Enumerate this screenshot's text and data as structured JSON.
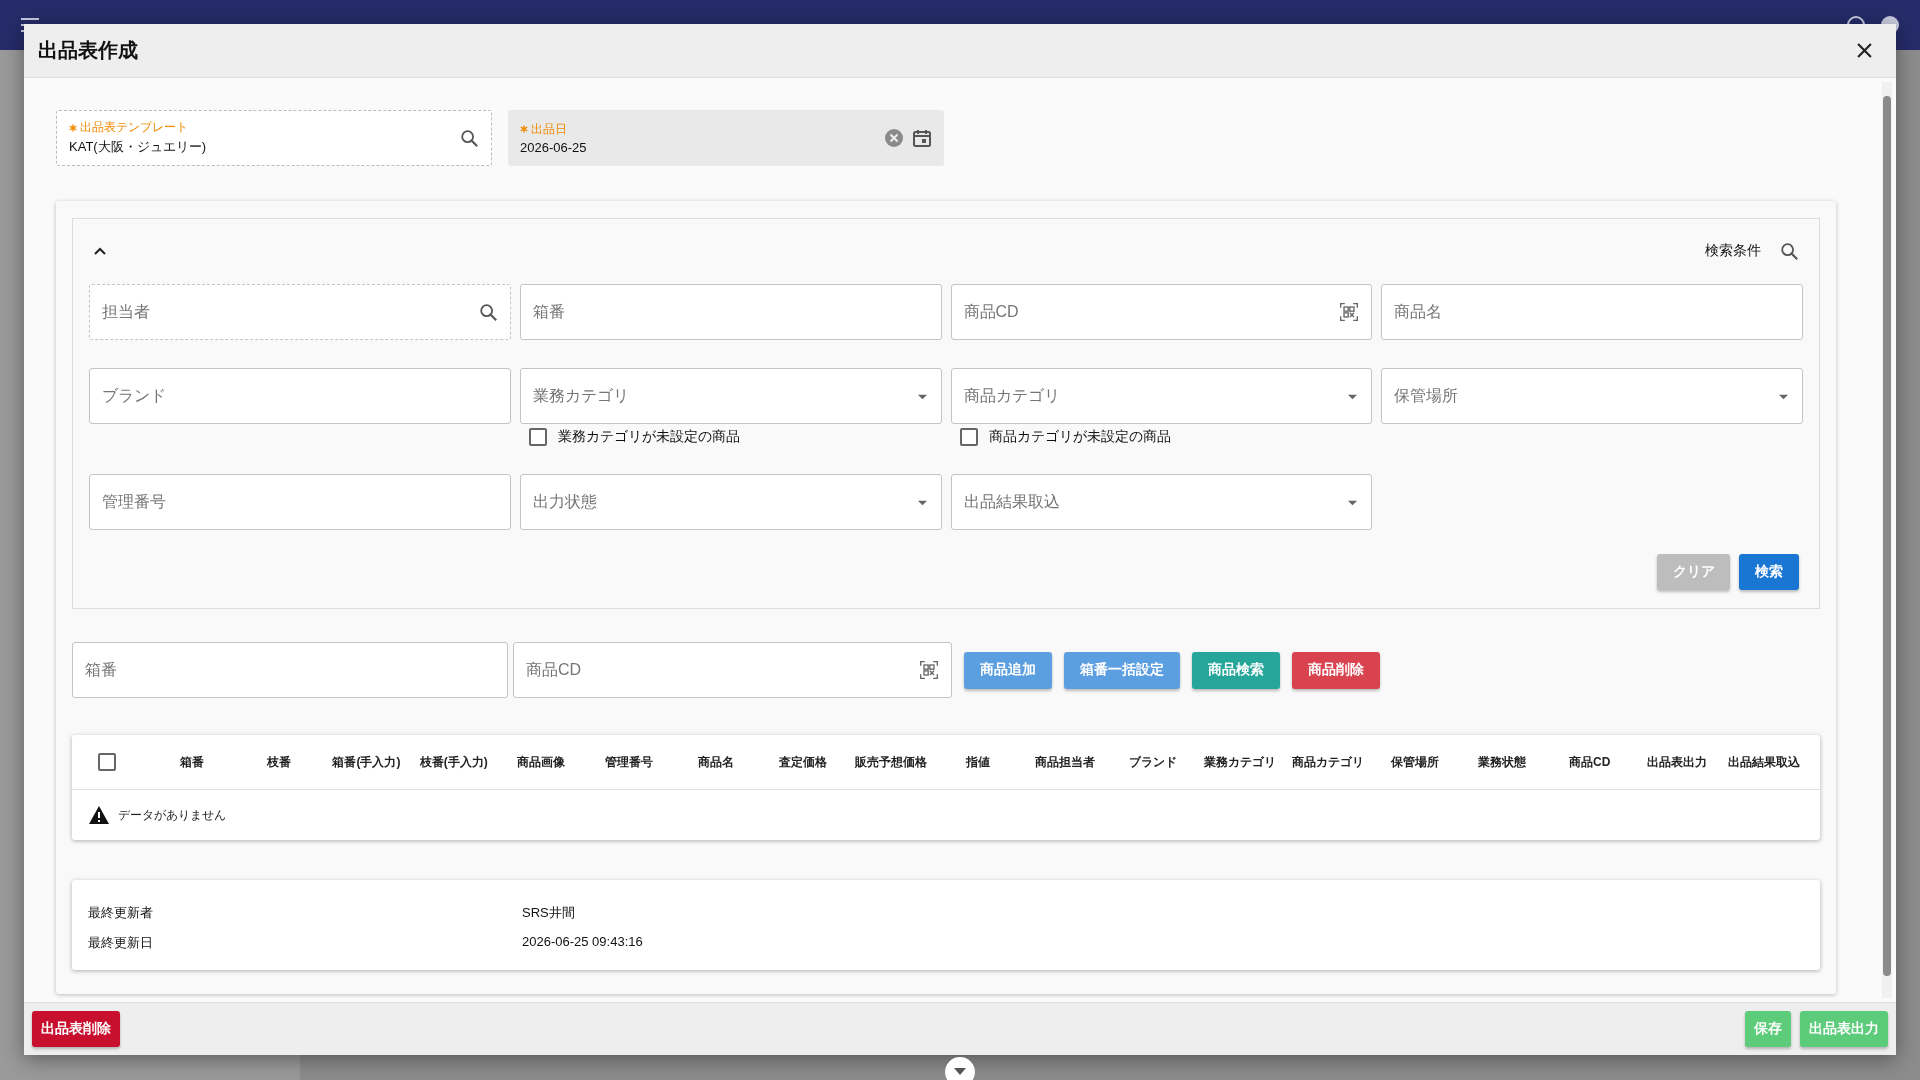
{
  "dialog": {
    "title": "出品表作成"
  },
  "header_fields": [
    {
      "label": "出品表テンプレート",
      "value": "KAT(大阪・ジュエリー)",
      "required": true,
      "kind": "lookup"
    },
    {
      "label": "出品日",
      "value": "2026-06-25",
      "required": true,
      "kind": "date"
    }
  ],
  "search_panel": {
    "expanded": true,
    "title": "検索条件",
    "rows": [
      [
        {
          "placeholder": "担当者",
          "kind": "lookup"
        },
        {
          "placeholder": "箱番",
          "kind": "text"
        },
        {
          "placeholder": "商品CD",
          "kind": "scan"
        },
        {
          "placeholder": "商品名",
          "kind": "text"
        }
      ],
      [
        {
          "placeholder": "ブランド",
          "kind": "text"
        },
        {
          "placeholder": "業務カテゴリ",
          "kind": "select",
          "checkbox": {
            "label": "業務カテゴリが未設定の商品",
            "checked": false
          }
        },
        {
          "placeholder": "商品カテゴリ",
          "kind": "select",
          "checkbox": {
            "label": "商品カテゴリが未設定の商品",
            "checked": false
          }
        },
        {
          "placeholder": "保管場所",
          "kind": "select"
        }
      ],
      [
        {
          "placeholder": "管理番号",
          "kind": "text"
        },
        {
          "placeholder": "出力状態",
          "kind": "select"
        },
        {
          "placeholder": "出品結果取込",
          "kind": "select"
        }
      ]
    ],
    "buttons": [
      {
        "label": "クリア",
        "disabled": true
      },
      {
        "label": "検索",
        "disabled": false
      }
    ]
  },
  "add_bar": {
    "fields": [
      {
        "placeholder": "箱番",
        "kind": "text"
      },
      {
        "placeholder": "商品CD",
        "kind": "scan"
      }
    ],
    "buttons": [
      {
        "label": "商品追加",
        "color": "#5c9fe0"
      },
      {
        "label": "箱番一括設定",
        "color": "#5c9fe0"
      },
      {
        "label": "商品検索",
        "color": "#26a69a"
      },
      {
        "label": "商品削除",
        "color": "#d9434f"
      }
    ]
  },
  "table": {
    "select_all": {
      "checked": false
    },
    "columns": [
      "箱番",
      "枝番",
      "箱番(手入力)",
      "枝番(手入力)",
      "商品画像",
      "管理番号",
      "商品名",
      "査定価格",
      "販売予想価格",
      "指値",
      "商品担当者",
      "ブランド",
      "業務カテゴリ",
      "商品カテゴリ",
      "保管場所",
      "業務状態",
      "商品CD",
      "出品表出力",
      "出品結果取込"
    ],
    "empty_message": "データがありません"
  },
  "info": [
    {
      "label": "最終更新者",
      "value": "SRS井間"
    },
    {
      "label": "最終更新日",
      "value": "2026-06-25 09:43:16"
    }
  ],
  "footer": {
    "left": [
      {
        "label": "出品表削除",
        "color": "#c8102e"
      }
    ],
    "right": [
      {
        "label": "保存",
        "color": "#5ccb7a"
      },
      {
        "label": "出品表出力",
        "color": "#5ccb7a"
      }
    ]
  }
}
